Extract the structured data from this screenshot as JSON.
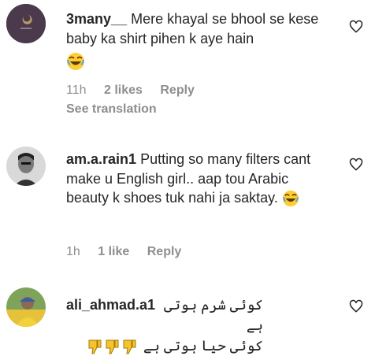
{
  "comments": [
    {
      "username": "3many__",
      "text": "Mere khayal se bhool se kese baby ka shirt pihen k aye hain",
      "time": "11h",
      "likes": "2 likes",
      "reply": "Reply",
      "see_translation": "See translation"
    },
    {
      "username": "am.a.rain1",
      "text": "Putting so many filters cant make u English girl.. aap tou Arabic beauty k shoes tuk nahi ja saktay.",
      "time": "1h",
      "likes": "1 like",
      "reply": "Reply"
    },
    {
      "username": "ali_ahmad.a1",
      "text_line1": "کوئی شرم ہوتی ہے",
      "text_line2": "کوئی حیا ہوتی ہے"
    }
  ]
}
